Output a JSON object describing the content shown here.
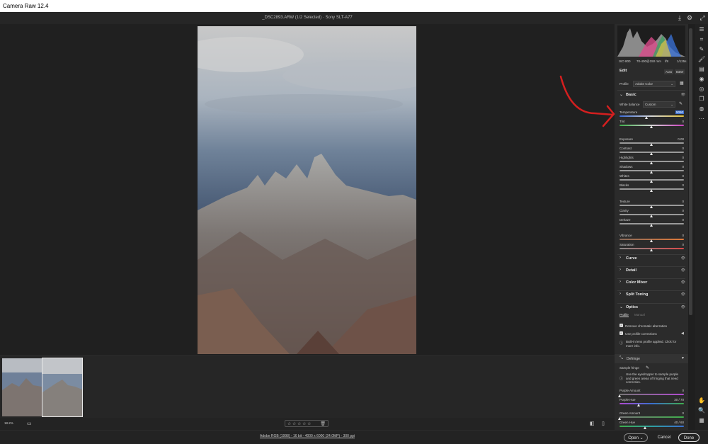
{
  "window": {
    "title": "Camera Raw 12.4"
  },
  "header": {
    "file_title": "_DSC2893.ARW (1/2 Selected)  ·  Sony SLT-A77"
  },
  "info": {
    "iso": "ISO 800",
    "lens": "70-400@150 mm",
    "aperture": "f/8",
    "shutter": "1/125s"
  },
  "edit": {
    "title": "Edit",
    "auto_label": "Auto",
    "bw_label": "B&W",
    "profile_label": "Profile",
    "profile_value": "Adobe Color"
  },
  "basic": {
    "title": "Basic",
    "wb_label": "White balance",
    "wb_value": "Custom",
    "sliders": [
      {
        "label": "Temperature",
        "value": "5050",
        "pos": 0.42
      },
      {
        "label": "Tint",
        "value": "0",
        "pos": 0.5
      },
      {
        "label": "Exposure",
        "value": "0.00",
        "pos": 0.5
      },
      {
        "label": "Contrast",
        "value": "0",
        "pos": 0.5
      },
      {
        "label": "Highlights",
        "value": "0",
        "pos": 0.5
      },
      {
        "label": "Shadows",
        "value": "0",
        "pos": 0.5
      },
      {
        "label": "Whites",
        "value": "0",
        "pos": 0.5
      },
      {
        "label": "Blacks",
        "value": "0",
        "pos": 0.5
      },
      {
        "label": "Texture",
        "value": "0",
        "pos": 0.5
      },
      {
        "label": "Clarity",
        "value": "0",
        "pos": 0.5
      },
      {
        "label": "Dehaze",
        "value": "0",
        "pos": 0.5
      },
      {
        "label": "Vibrance",
        "value": "0",
        "pos": 0.5
      },
      {
        "label": "Saturation",
        "value": "0",
        "pos": 0.5
      }
    ]
  },
  "sections": [
    "Curve",
    "Detail",
    "Color Mixer",
    "Split Toning"
  ],
  "optics": {
    "title": "Optics",
    "tab_profile": "Profile",
    "tab_manual": "Manual",
    "remove_ca": "Remove chromatic aberration",
    "use_profile": "Use profile corrections",
    "info_text": "Built-in lens profile applied.  Click for more info."
  },
  "defringe": {
    "title": "Defringe",
    "sample_label": "Sample fringe",
    "help": "Use the eyedropper to sample purple and green areas of fringing that need correction.",
    "sliders": [
      {
        "label": "Purple Amount",
        "value": "0",
        "pos": 0.0
      },
      {
        "label": "Purple Hue",
        "value": "30 / 70",
        "pos": 0.3
      },
      {
        "label": "Green Amount",
        "value": "0",
        "pos": 0.0
      },
      {
        "label": "Green Hue",
        "value": "40 / 60",
        "pos": 0.4
      }
    ]
  },
  "bottom": {
    "zoom": "18.2%",
    "rating": "☆ ☆ ☆ ☆ ☆"
  },
  "footer": {
    "workflow": "Adobe RGB (1998) - 16 bit - 4000 x 6000 (24.0MP) - 300 ppi",
    "open_label": "Open",
    "cancel_label": "Cancel",
    "done_label": "Done"
  }
}
